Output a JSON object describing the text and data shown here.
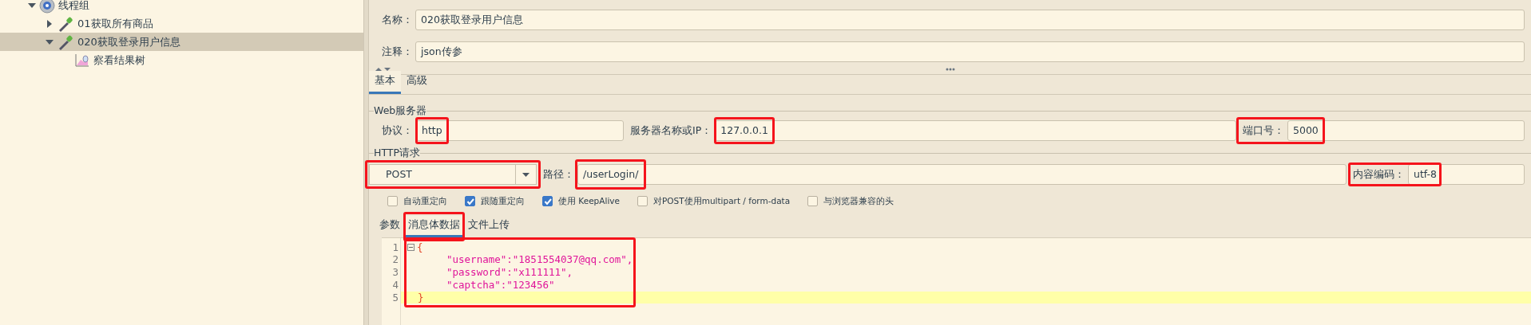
{
  "tree": [
    {
      "label": "线程组",
      "kind": "group",
      "expanded": true,
      "selected": false,
      "children": [
        {
          "label": "01获取所有商品",
          "kind": "sampler",
          "expanded": false,
          "selected": false
        },
        {
          "label": "020获取登录用户信息",
          "kind": "sampler",
          "expanded": true,
          "selected": true,
          "children": [
            {
              "label": "察看结果树",
              "kind": "listener",
              "selected": false
            }
          ]
        }
      ]
    }
  ],
  "name_field": {
    "label": "名称：",
    "value": "020获取登录用户信息"
  },
  "comment_field": {
    "label": "注释：",
    "value": "json传参"
  },
  "config_tabs": [
    {
      "label": "基本",
      "selected": true
    },
    {
      "label": "高级",
      "selected": false
    }
  ],
  "web_server": {
    "title": "Web服务器",
    "protocol": {
      "label": "协议：",
      "value": "http",
      "highlighted": true
    },
    "server": {
      "label": "服务器名称或IP：",
      "value": "127.0.0.1",
      "highlighted": true
    },
    "port": {
      "label": "端口号：",
      "value": "5000",
      "highlighted": true
    }
  },
  "http_request": {
    "title": "HTTP请求",
    "method": {
      "value": "POST",
      "highlighted": true
    },
    "path": {
      "label": "路径：",
      "value": "/userLogin/",
      "highlighted": true
    },
    "encoding": {
      "label": "内容编码：",
      "value": "utf-8",
      "highlighted": true
    }
  },
  "options": [
    {
      "label": "自动重定向",
      "checked": false
    },
    {
      "label": "跟随重定向",
      "checked": true
    },
    {
      "label": "使用 KeepAlive",
      "checked": true
    },
    {
      "label": "对POST使用multipart / form-data",
      "checked": false
    },
    {
      "label": "与浏览器兼容的头",
      "checked": false
    }
  ],
  "body_tabs": [
    {
      "label": "参数",
      "selected": false,
      "highlighted": false
    },
    {
      "label": "消息体数据",
      "selected": true,
      "highlighted": true
    },
    {
      "label": "文件上传",
      "selected": false,
      "highlighted": false
    }
  ],
  "editor": {
    "highlighted": true,
    "lines": [
      {
        "number": "1",
        "text": "{",
        "kind": "brace",
        "foldable": true,
        "current": false
      },
      {
        "number": "2",
        "text": "\"username\":\"1851554037@qq.com\",",
        "kind": "pair",
        "foldable": false,
        "current": false
      },
      {
        "number": "3",
        "text": "\"password\":\"x111111\",",
        "kind": "pair",
        "foldable": false,
        "current": false
      },
      {
        "number": "4",
        "text": "\"captcha\":\"123456\"",
        "kind": "pair",
        "foldable": false,
        "current": false
      },
      {
        "number": "5",
        "text": "}",
        "kind": "brace",
        "foldable": false,
        "current": true
      }
    ]
  }
}
